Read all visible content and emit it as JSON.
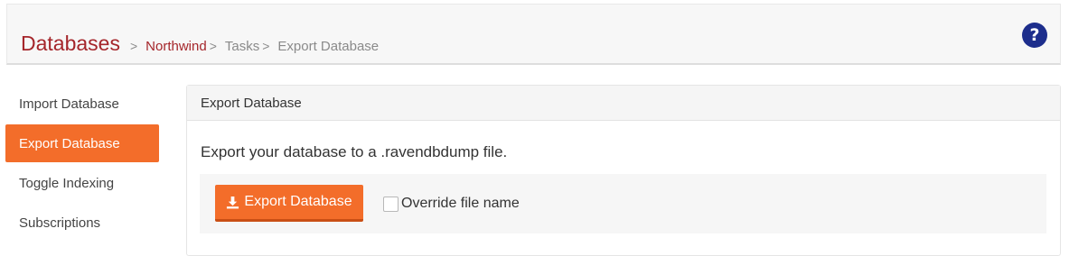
{
  "header": {
    "breadcrumb": {
      "root": "Databases",
      "separator": ">",
      "items": [
        "Northwind",
        "Tasks",
        "Export Database"
      ]
    },
    "help_icon": "question-circle-icon"
  },
  "sidebar": {
    "items": [
      {
        "label": "Import Database",
        "active": false
      },
      {
        "label": "Export Database",
        "active": true
      },
      {
        "label": "Toggle Indexing",
        "active": false
      },
      {
        "label": "Subscriptions",
        "active": false
      }
    ]
  },
  "panel": {
    "title": "Export Database",
    "description": "Export your database to a .ravendbdump file.",
    "export_button": {
      "label": "Export Database",
      "icon": "download-icon"
    },
    "override_checkbox": {
      "label": "Override file name",
      "checked": false
    }
  },
  "colors": {
    "accent": "#f36d2a",
    "brand": "#a5262b",
    "help": "#1d2e8c"
  }
}
